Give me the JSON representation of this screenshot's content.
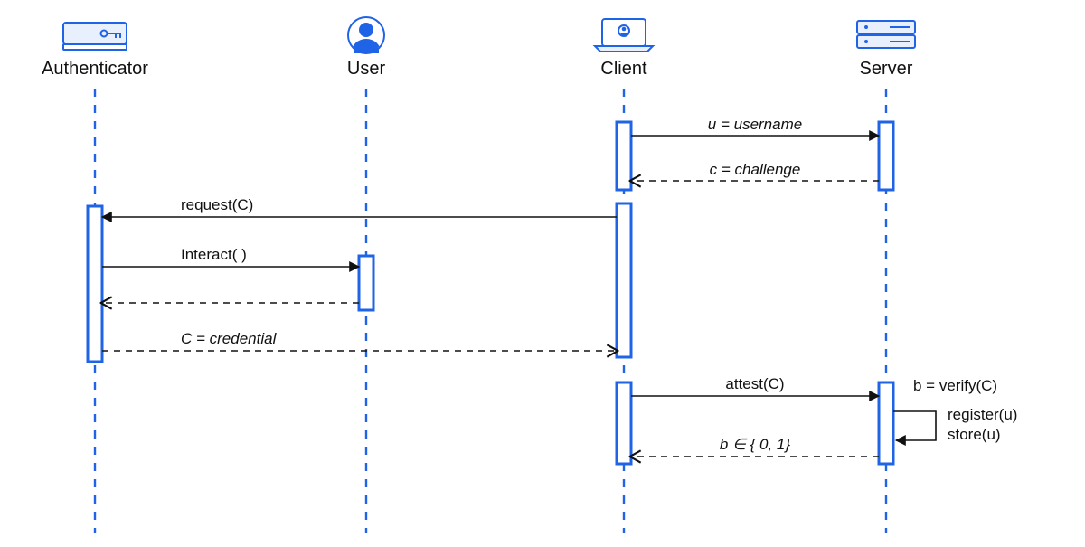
{
  "lanes": {
    "authenticator": "Authenticator",
    "user": "User",
    "client": "Client",
    "server": "Server"
  },
  "messages": {
    "m1": "u = username",
    "m2": "c = challenge",
    "m3": "request(C)",
    "m4": "Interact( )",
    "m5": "C = credential",
    "m6": "attest(C)",
    "m7": "b ∈ { 0, 1}",
    "side1": "b = verify(C)",
    "side2": "register(u)",
    "side3": "store(u)"
  },
  "colors": {
    "accent": "#1F63E6",
    "iconFill": "#E8F0FD"
  },
  "chart_data": {
    "type": "sequence-diagram",
    "participants": [
      "Authenticator",
      "User",
      "Client",
      "Server"
    ],
    "messages": [
      {
        "from": "Client",
        "to": "Server",
        "label": "u = username",
        "style": "solid"
      },
      {
        "from": "Server",
        "to": "Client",
        "label": "c = challenge",
        "style": "dashed"
      },
      {
        "from": "Client",
        "to": "Authenticator",
        "label": "request(C)",
        "style": "solid"
      },
      {
        "from": "Authenticator",
        "to": "User",
        "label": "Interact( )",
        "style": "solid"
      },
      {
        "from": "User",
        "to": "Authenticator",
        "label": "",
        "style": "dashed"
      },
      {
        "from": "Authenticator",
        "to": "Client",
        "label": "C = credential",
        "style": "dashed"
      },
      {
        "from": "Client",
        "to": "Server",
        "label": "attest(C)",
        "style": "solid",
        "sideNote": "b = verify(C)"
      },
      {
        "from": "Server",
        "to": "Server",
        "label": "register(u); store(u)",
        "style": "self"
      },
      {
        "from": "Server",
        "to": "Client",
        "label": "b ∈ {0, 1}",
        "style": "dashed"
      }
    ]
  }
}
